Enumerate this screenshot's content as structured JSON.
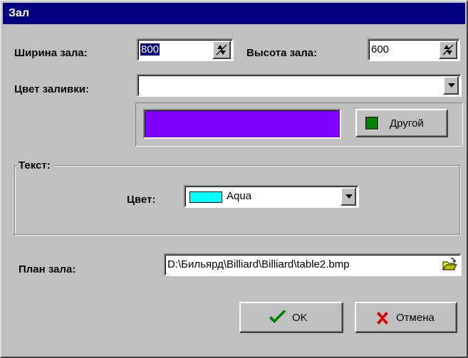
{
  "window": {
    "title": "Зал"
  },
  "size": {
    "width_label": "Ширина зала:",
    "width_value": "800",
    "height_label": "Высота зала:",
    "height_value": "600"
  },
  "fill": {
    "label": "Цвет заливки:",
    "value": "",
    "swatch_color": "#8000ff",
    "other_button_label": "Другой",
    "other_button_swatch_color": "#008000"
  },
  "text_group": {
    "title": "Текст:",
    "color_label": "Цвет:",
    "color_value": "Aqua",
    "color_swatch": "#00ffff"
  },
  "plan": {
    "label": "План зала:",
    "path": "D:\\Бильярд\\Billiard\\Billiard\\table2.bmp"
  },
  "buttons": {
    "ok_label": "OK",
    "cancel_label": "Отмена"
  },
  "icons": {
    "spin": "updown-spin-icon",
    "dropdown": "chevron-down-icon",
    "open_folder": "open-folder-icon",
    "ok": "checkmark-icon",
    "cancel": "cross-icon"
  }
}
